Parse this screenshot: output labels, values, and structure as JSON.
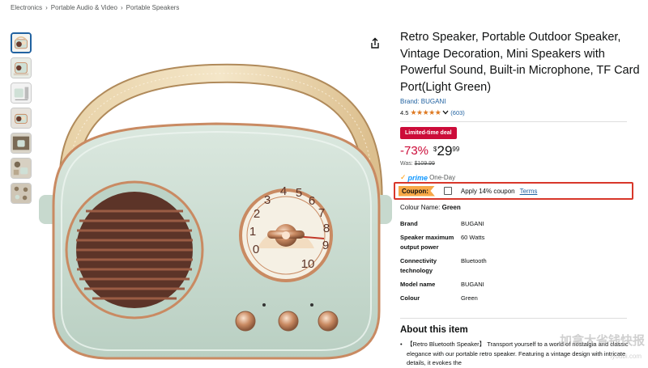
{
  "breadcrumb": [
    "Electronics",
    "Portable Audio & Video",
    "Portable Speakers"
  ],
  "breadcrumb_sep": "›",
  "product": {
    "title": "Retro Speaker, Portable Outdoor Speaker, Vintage Decoration, Mini Speakers with Powerful Sound, Built-in Microphone, TF Card Port(Light Green)",
    "brand": "Brand: BUGANI",
    "rating_value": "4.5",
    "stars": "★★★★★",
    "rating_count": "(603)",
    "deal_badge": "Limited-time deal",
    "discount": "-73%",
    "currency": "$",
    "price_whole": "29",
    "price_fraction": "99",
    "was_label": "Was:",
    "was_price": "$109.99",
    "prime_label": "prime",
    "prime_delivery": "One-Day",
    "coupon_label": "Coupon:",
    "coupon_text": "Apply 14% coupon",
    "terms_link": "Terms",
    "colour_label": "Colour Name:",
    "colour_value": "Green",
    "specs": [
      {
        "k": "Brand",
        "v": "BUGANI"
      },
      {
        "k": "Speaker maximum output power",
        "v": "60 Watts"
      },
      {
        "k": "Connectivity technology",
        "v": "Bluetooth"
      },
      {
        "k": "Model name",
        "v": "BUGANI"
      },
      {
        "k": "Colour",
        "v": "Green"
      }
    ],
    "about_heading": "About this item",
    "bullet_1": "【Retro Bluetooth Speaker】 Transport yourself to a world of nostalgia and classic elegance with our portable retro speaker. Featuring a vintage design with intricate details, it evokes the"
  },
  "dial_numbers": [
    "0",
    "1",
    "2",
    "3",
    "4",
    "5",
    "6",
    "7",
    "8",
    "9",
    "10"
  ],
  "watermark": "加拿大省钱快报",
  "watermark_small": "iyoubi.com",
  "colors": {
    "link": "#2162a1",
    "deal": "#cc0c39",
    "coupon_border": "#d8372a",
    "coupon_badge": "#f7a847",
    "body_green": "#cfe0d6",
    "trim_copper": "#c98a62"
  },
  "icons": {
    "share": "share-icon",
    "dropdown": "chevron-down-icon",
    "prime_check": "check-icon"
  }
}
